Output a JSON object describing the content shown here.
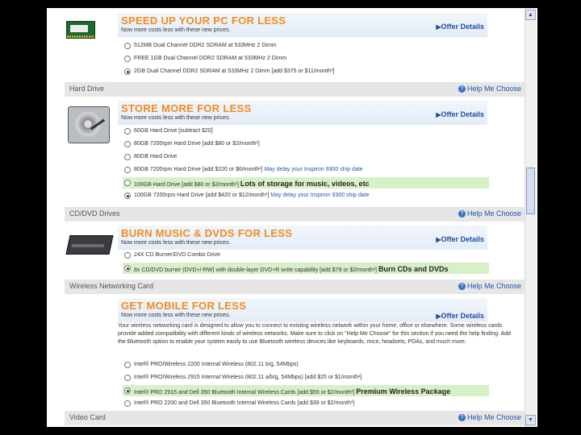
{
  "memory_section": {
    "banner": {
      "headline": "SPEED UP YOUR PC FOR LESS",
      "subline": "Now more costs less with these new prices.",
      "offer_link": "Offer Details"
    },
    "options": [
      {
        "label": "512MB Dual Channel DDR2 SDRAM at 533MHz 2 Dimm",
        "selected": false
      },
      {
        "label": "FREE 1GB Dual Channel DDR2 SDRAM at 533MHz 2 Dimm",
        "selected": false
      },
      {
        "label": "2GB Dual Channel DDR2 SDRAM at 533MHz 2 Dimm [add $375 or $11/month¹]",
        "selected": true
      }
    ]
  },
  "hard_drive_section": {
    "bar_title": "Hard Drive",
    "help_link": "Help Me Choose",
    "banner": {
      "headline": "STORE MORE FOR LESS",
      "subline": "Now more costs less with these new prices.",
      "offer_link": "Offer Details"
    },
    "options": [
      {
        "label": "60GB Hard Drive [subtract $20]",
        "note": "",
        "extra": "",
        "selected": false,
        "highlight": false
      },
      {
        "label": "80GB 7200rpm Hard Drive [add $80 or $2/month¹]",
        "note": "",
        "extra": "",
        "selected": false,
        "highlight": false
      },
      {
        "label": "80GB Hard Drive",
        "note": "",
        "extra": "",
        "selected": false,
        "highlight": false
      },
      {
        "label": "80GB 7200rpm Hard Drive [add $220 or $6/month¹]",
        "note": "May delay your Inspiron 9300 ship date",
        "extra": "",
        "selected": false,
        "highlight": false
      },
      {
        "label": "100GB Hard Drive [add $80 or $2/month¹]",
        "note": "",
        "extra": "Lots of storage for music, videos, etc",
        "selected": false,
        "highlight": true
      },
      {
        "label": "100GB 7200rpm Hard Drive [add $420 or $12/month¹]",
        "note": "May delay your Inspiron 9300 ship date",
        "extra": "",
        "selected": true,
        "highlight": false
      }
    ]
  },
  "cd_dvd_section": {
    "bar_title": "CD/DVD Drives",
    "help_link": "Help Me Choose",
    "banner": {
      "headline": "BURN MUSIC & DVDS FOR LESS",
      "subline": "Now more costs less with these new prices.",
      "offer_link": "Offer Details"
    },
    "options": [
      {
        "label": "24X CD Burner/DVD Combo Drive",
        "extra": "",
        "selected": false,
        "highlight": false
      },
      {
        "label": "8x CD/DVD burner (DVD+/-RW) with double-layer DVD+R write capability [add $79 or $2/month¹]",
        "extra": "Burn CDs and DVDs",
        "selected": true,
        "highlight": true
      }
    ]
  },
  "wireless_section": {
    "bar_title": "Wireless Networking Card",
    "help_link": "Help Me Choose",
    "banner": {
      "headline": "GET MOBILE FOR LESS",
      "subline": "Now more costs less with these new prices.",
      "offer_link": "Offer Details"
    },
    "description": "Your wireless networking card is designed to allow you to connect to existing wireless network within your home, office or elsewhere. Some wireless cards provide added compatibility with different kinds of wireless networks. Make sure to click on \"Help Me Choose\" for this section if you need the help finding. Add the Bluetooth option to enable your system easily to use Bluetooth wireless devices like keyboards, mice, headsets, PDAs, and much more.",
    "options": [
      {
        "label": "Intel® PRO/Wireless 2200 Internal Wireless (802.11 b/g, 54Mbps)",
        "extra": "",
        "selected": false,
        "highlight": false
      },
      {
        "label": "Intel® PRO/Wireless 2915 Internal Wireless (802.11 a/b/g, 54Mbps) [add $25 or $1/month¹]",
        "extra": "",
        "selected": false,
        "highlight": false
      },
      {
        "label": "Intel® PRO 2915 and Dell 350 Bluetooth Internal Wireless Cards [add $59 or $2/month¹]",
        "extra": "Premium Wireless Package",
        "selected": true,
        "highlight": true
      },
      {
        "label": "Intel® PRO 2200 and Dell 350 Bluetooth Internal Wireless Cards [add $39 or $2/month¹]",
        "extra": "",
        "selected": false,
        "highlight": false
      }
    ]
  },
  "video_section": {
    "bar_title": "Video Card",
    "help_link": "Help Me Choose"
  },
  "scrollbar": {
    "up_glyph": "▲",
    "down_glyph": "▼"
  },
  "icons": {
    "help": "?"
  }
}
